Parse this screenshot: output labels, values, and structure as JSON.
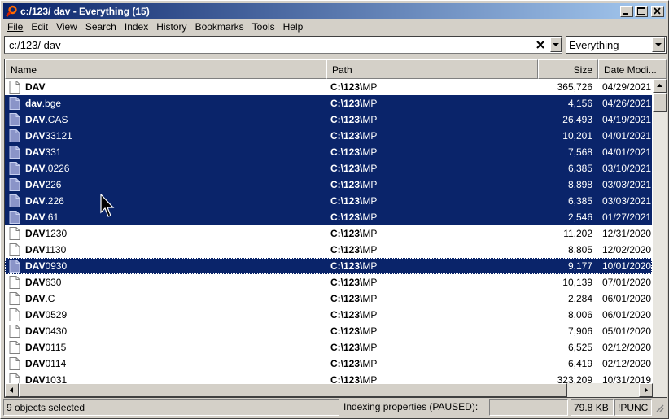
{
  "window": {
    "title": "c:/123/ dav - Everything (15)"
  },
  "menu": [
    "File",
    "Edit",
    "View",
    "Search",
    "Index",
    "History",
    "Bookmarks",
    "Tools",
    "Help"
  ],
  "search": {
    "value": "c:/123/ dav"
  },
  "filter": {
    "selected": "Everything"
  },
  "columns": {
    "name": "Name",
    "path": "Path",
    "size": "Size",
    "date": "Date Modi..."
  },
  "rows": [
    {
      "name_hl": "DAV",
      "name_rest": "",
      "path_hl": "C:\\123\\",
      "path_rest": "MP",
      "size": "365,726",
      "date": "04/29/2021",
      "selected": false
    },
    {
      "name_hl": "dav",
      "name_rest": ".bge",
      "path_hl": "C:\\123\\",
      "path_rest": "MP",
      "size": "4,156",
      "date": "04/26/2021",
      "selected": true
    },
    {
      "name_hl": "DAV",
      "name_rest": ".CAS",
      "path_hl": "C:\\123\\",
      "path_rest": "MP",
      "size": "26,493",
      "date": "04/19/2021",
      "selected": true
    },
    {
      "name_hl": "DAV",
      "name_rest": "33121",
      "path_hl": "C:\\123\\",
      "path_rest": "MP",
      "size": "10,201",
      "date": "04/01/2021",
      "selected": true
    },
    {
      "name_hl": "DAV",
      "name_rest": "331",
      "path_hl": "C:\\123\\",
      "path_rest": "MP",
      "size": "7,568",
      "date": "04/01/2021",
      "selected": true
    },
    {
      "name_hl": "DAV",
      "name_rest": ".0226",
      "path_hl": "C:\\123\\",
      "path_rest": "MP",
      "size": "6,385",
      "date": "03/10/2021",
      "selected": true
    },
    {
      "name_hl": "DAV",
      "name_rest": "226",
      "path_hl": "C:\\123\\",
      "path_rest": "MP",
      "size": "8,898",
      "date": "03/03/2021",
      "selected": true
    },
    {
      "name_hl": "DAV",
      "name_rest": ".226",
      "path_hl": "C:\\123\\",
      "path_rest": "MP",
      "size": "6,385",
      "date": "03/03/2021",
      "selected": true
    },
    {
      "name_hl": "DAV",
      "name_rest": ".61",
      "path_hl": "C:\\123\\",
      "path_rest": "MP",
      "size": "2,546",
      "date": "01/27/2021",
      "selected": true
    },
    {
      "name_hl": "DAV",
      "name_rest": "1230",
      "path_hl": "C:\\123\\",
      "path_rest": "MP",
      "size": "11,202",
      "date": "12/31/2020",
      "selected": false
    },
    {
      "name_hl": "DAV",
      "name_rest": "1130",
      "path_hl": "C:\\123\\",
      "path_rest": "MP",
      "size": "8,805",
      "date": "12/02/2020",
      "selected": false
    },
    {
      "name_hl": "DAV",
      "name_rest": "0930",
      "path_hl": "C:\\123\\",
      "path_rest": "MP",
      "size": "9,177",
      "date": "10/01/2020",
      "selected": true,
      "focus": true
    },
    {
      "name_hl": "DAV",
      "name_rest": "630",
      "path_hl": "C:\\123\\",
      "path_rest": "MP",
      "size": "10,139",
      "date": "07/01/2020",
      "selected": false
    },
    {
      "name_hl": "DAV",
      "name_rest": ".C",
      "path_hl": "C:\\123\\",
      "path_rest": "MP",
      "size": "2,284",
      "date": "06/01/2020",
      "selected": false
    },
    {
      "name_hl": "DAV",
      "name_rest": "0529",
      "path_hl": "C:\\123\\",
      "path_rest": "MP",
      "size": "8,006",
      "date": "06/01/2020",
      "selected": false
    },
    {
      "name_hl": "DAV",
      "name_rest": "0430",
      "path_hl": "C:\\123\\",
      "path_rest": "MP",
      "size": "7,906",
      "date": "05/01/2020",
      "selected": false
    },
    {
      "name_hl": "DAV",
      "name_rest": "0115",
      "path_hl": "C:\\123\\",
      "path_rest": "MP",
      "size": "6,525",
      "date": "02/12/2020",
      "selected": false
    },
    {
      "name_hl": "DAV",
      "name_rest": "0114",
      "path_hl": "C:\\123\\",
      "path_rest": "MP",
      "size": "6,419",
      "date": "02/12/2020",
      "selected": false
    },
    {
      "name_hl": "DAV",
      "name_rest": "1031",
      "path_hl": "C:\\123\\",
      "path_rest": "MP",
      "size": "323,209",
      "date": "10/31/2019",
      "selected": false
    }
  ],
  "status": {
    "selected_text": "9 objects selected",
    "indexing_text": "Indexing properties (PAUSED):",
    "size_text": "79.8 KB",
    "mode_text": "!PUNC"
  },
  "colors": {
    "selection": "#0a246a",
    "titlebar_start": "#0a246a",
    "titlebar_end": "#a6caf0"
  }
}
